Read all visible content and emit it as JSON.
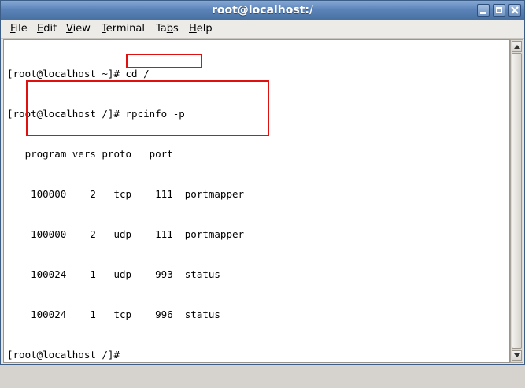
{
  "window": {
    "title": "root@localhost:/"
  },
  "menu": [
    {
      "pre": "",
      "u": "F",
      "post": "ile"
    },
    {
      "pre": "",
      "u": "E",
      "post": "dit"
    },
    {
      "pre": "",
      "u": "V",
      "post": "iew"
    },
    {
      "pre": "",
      "u": "T",
      "post": "erminal"
    },
    {
      "pre": "Ta",
      "u": "b",
      "post": "s"
    },
    {
      "pre": "",
      "u": "H",
      "post": "elp"
    }
  ],
  "terminal": {
    "line1": "[root@localhost ~]# cd /",
    "line2_prompt": "[root@localhost /]# ",
    "line2_cmd": "rpcinfo -p",
    "header": "   program vers proto   port",
    "rows": [
      "    100000    2   tcp    111  portmapper",
      "    100000    2   udp    111  portmapper",
      "    100024    1   udp    993  status",
      "    100024    1   tcp    996  status"
    ],
    "last": "[root@localhost /]# "
  }
}
